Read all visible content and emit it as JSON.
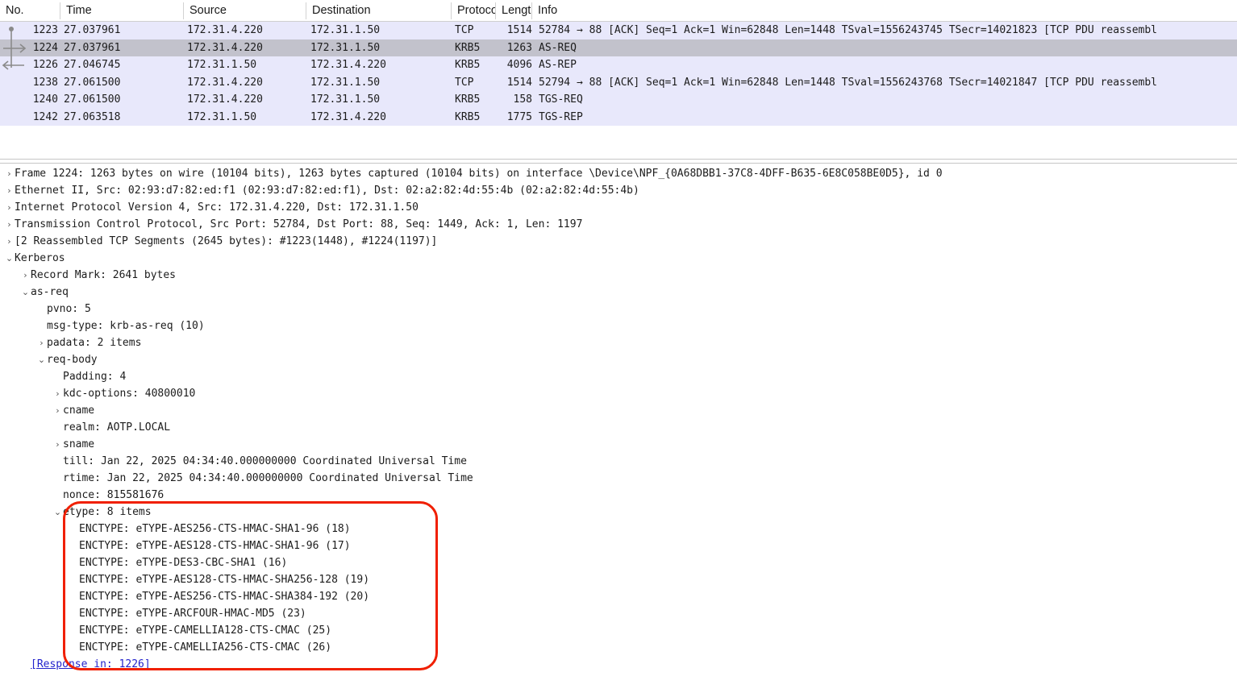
{
  "packet_list": {
    "columns": [
      {
        "key": "no",
        "label": "No."
      },
      {
        "key": "time",
        "label": "Time"
      },
      {
        "key": "src",
        "label": "Source"
      },
      {
        "key": "dst",
        "label": "Destination"
      },
      {
        "key": "proto",
        "label": "Protocol"
      },
      {
        "key": "len",
        "label": "Lengtl"
      },
      {
        "key": "info",
        "label": "Info"
      }
    ],
    "rows": [
      {
        "no": "1223",
        "time": "27.037961",
        "src": "172.31.4.220",
        "dst": "172.31.1.50",
        "proto": "TCP",
        "len": "1514",
        "info": "52784 → 88 [ACK] Seq=1 Ack=1 Win=62848 Len=1448 TSval=1556243745 TSecr=14021823 [TCP PDU reassembl",
        "selected": false,
        "marker": "related-first"
      },
      {
        "no": "1224",
        "time": "27.037961",
        "src": "172.31.4.220",
        "dst": "172.31.1.50",
        "proto": "KRB5",
        "len": "1263",
        "info": "AS-REQ",
        "selected": true,
        "marker": "current-request"
      },
      {
        "no": "1226",
        "time": "27.046745",
        "src": "172.31.1.50",
        "dst": "172.31.4.220",
        "proto": "KRB5",
        "len": "4096",
        "info": "AS-REP",
        "selected": false,
        "marker": "related-response"
      },
      {
        "no": "1238",
        "time": "27.061500",
        "src": "172.31.4.220",
        "dst": "172.31.1.50",
        "proto": "TCP",
        "len": "1514",
        "info": "52794 → 88 [ACK] Seq=1 Ack=1 Win=62848 Len=1448 TSval=1556243768 TSecr=14021847 [TCP PDU reassembl",
        "selected": false,
        "marker": "none"
      },
      {
        "no": "1240",
        "time": "27.061500",
        "src": "172.31.4.220",
        "dst": "172.31.1.50",
        "proto": "KRB5",
        "len": "158",
        "info": "TGS-REQ",
        "selected": false,
        "marker": "none"
      },
      {
        "no": "1242",
        "time": "27.063518",
        "src": "172.31.1.50",
        "dst": "172.31.4.220",
        "proto": "KRB5",
        "len": "1775",
        "info": "TGS-REP",
        "selected": false,
        "marker": "none"
      }
    ]
  },
  "detail_tree": [
    {
      "indent": 0,
      "twisty": "collapsed",
      "label": "Frame 1224: 1263 bytes on wire (10104 bits), 1263 bytes captured (10104 bits) on interface \\Device\\NPF_{0A68DBB1-37C8-4DFF-B635-6E8C058BE0D5}, id 0",
      "link": false
    },
    {
      "indent": 0,
      "twisty": "collapsed",
      "label": "Ethernet II, Src: 02:93:d7:82:ed:f1 (02:93:d7:82:ed:f1), Dst: 02:a2:82:4d:55:4b (02:a2:82:4d:55:4b)",
      "link": false
    },
    {
      "indent": 0,
      "twisty": "collapsed",
      "label": "Internet Protocol Version 4, Src: 172.31.4.220, Dst: 172.31.1.50",
      "link": false
    },
    {
      "indent": 0,
      "twisty": "collapsed",
      "label": "Transmission Control Protocol, Src Port: 52784, Dst Port: 88, Seq: 1449, Ack: 1, Len: 1197",
      "link": false
    },
    {
      "indent": 0,
      "twisty": "collapsed",
      "label": "[2 Reassembled TCP Segments (2645 bytes): #1223(1448), #1224(1197)]",
      "link": false
    },
    {
      "indent": 0,
      "twisty": "expanded",
      "label": "Kerberos",
      "link": false
    },
    {
      "indent": 1,
      "twisty": "collapsed",
      "label": "Record Mark: 2641 bytes",
      "link": false
    },
    {
      "indent": 1,
      "twisty": "expanded",
      "label": "as-req",
      "link": false
    },
    {
      "indent": 2,
      "twisty": "none",
      "label": "pvno: 5",
      "link": false
    },
    {
      "indent": 2,
      "twisty": "none",
      "label": "msg-type: krb-as-req (10)",
      "link": false
    },
    {
      "indent": 2,
      "twisty": "collapsed",
      "label": "padata: 2 items",
      "link": false
    },
    {
      "indent": 2,
      "twisty": "expanded",
      "label": "req-body",
      "link": false
    },
    {
      "indent": 3,
      "twisty": "none",
      "label": "Padding: 4",
      "link": false
    },
    {
      "indent": 3,
      "twisty": "collapsed",
      "label": "kdc-options: 40800010",
      "link": false
    },
    {
      "indent": 3,
      "twisty": "collapsed",
      "label": "cname",
      "link": false
    },
    {
      "indent": 3,
      "twisty": "none",
      "label": "realm: AOTP.LOCAL",
      "link": false
    },
    {
      "indent": 3,
      "twisty": "collapsed",
      "label": "sname",
      "link": false
    },
    {
      "indent": 3,
      "twisty": "none",
      "label": "till: Jan 22, 2025 04:34:40.000000000 Coordinated Universal Time",
      "link": false
    },
    {
      "indent": 3,
      "twisty": "none",
      "label": "rtime: Jan 22, 2025 04:34:40.000000000 Coordinated Universal Time",
      "link": false
    },
    {
      "indent": 3,
      "twisty": "none",
      "label": "nonce: 815581676",
      "link": false
    },
    {
      "indent": 3,
      "twisty": "expanded",
      "label": "etype: 8 items",
      "link": false
    },
    {
      "indent": 4,
      "twisty": "none",
      "label": "ENCTYPE: eTYPE-AES256-CTS-HMAC-SHA1-96 (18)",
      "link": false
    },
    {
      "indent": 4,
      "twisty": "none",
      "label": "ENCTYPE: eTYPE-AES128-CTS-HMAC-SHA1-96 (17)",
      "link": false
    },
    {
      "indent": 4,
      "twisty": "none",
      "label": "ENCTYPE: eTYPE-DES3-CBC-SHA1 (16)",
      "link": false
    },
    {
      "indent": 4,
      "twisty": "none",
      "label": "ENCTYPE: eTYPE-AES128-CTS-HMAC-SHA256-128 (19)",
      "link": false
    },
    {
      "indent": 4,
      "twisty": "none",
      "label": "ENCTYPE: eTYPE-AES256-CTS-HMAC-SHA384-192 (20)",
      "link": false
    },
    {
      "indent": 4,
      "twisty": "none",
      "label": "ENCTYPE: eTYPE-ARCFOUR-HMAC-MD5 (23)",
      "link": false
    },
    {
      "indent": 4,
      "twisty": "none",
      "label": "ENCTYPE: eTYPE-CAMELLIA128-CTS-CMAC (25)",
      "link": false
    },
    {
      "indent": 4,
      "twisty": "none",
      "label": "ENCTYPE: eTYPE-CAMELLIA256-CTS-CMAC (26)",
      "link": false
    },
    {
      "indent": 1,
      "twisty": "none",
      "label": "[Response in: 1226]",
      "link": true
    }
  ],
  "annotation": {
    "shape": "rounded-rectangle",
    "color": "#f01f00"
  },
  "colors": {
    "row_default_bg": "#e8e8fb",
    "row_selected_bg": "#c2c2cc",
    "pane_bg": "#ffffff",
    "text": "#1c1c1c",
    "link": "#2222cc",
    "annotation": "#f01f00"
  }
}
